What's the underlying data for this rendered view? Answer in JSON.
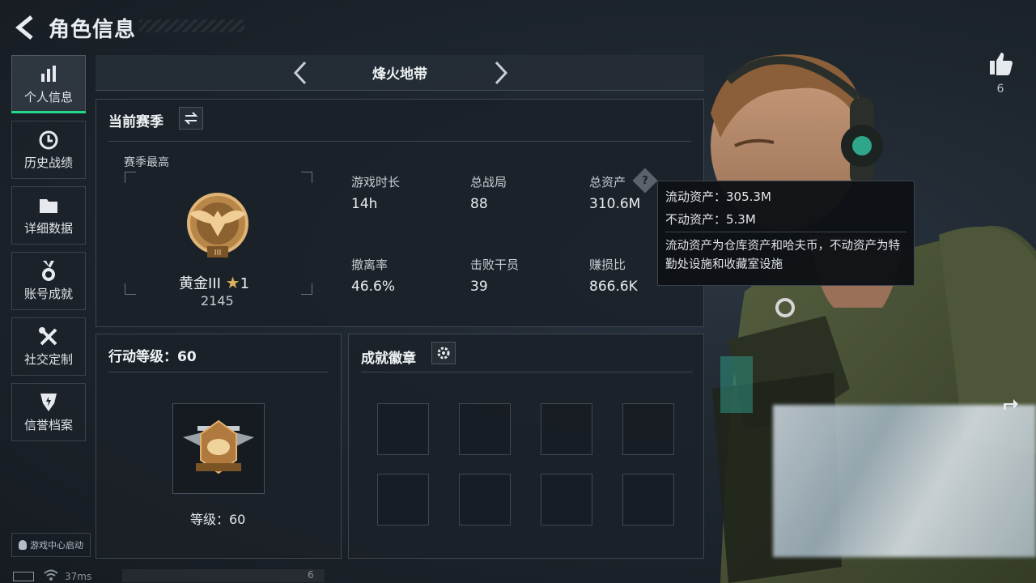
{
  "header": {
    "title": "角色信息"
  },
  "sidebar": {
    "items": [
      {
        "label": "个人信息",
        "icon": "bar-chart-icon",
        "active": true
      },
      {
        "label": "历史战绩",
        "icon": "clock-icon",
        "active": false
      },
      {
        "label": "详细数据",
        "icon": "folder-icon",
        "active": false
      },
      {
        "label": "账号成就",
        "icon": "medal-icon",
        "active": false
      },
      {
        "label": "社交定制",
        "icon": "tools-icon",
        "active": false
      },
      {
        "label": "信誉档案",
        "icon": "shield-icon",
        "active": false
      }
    ],
    "game_center": "游戏中心启动"
  },
  "status": {
    "ping": "37ms",
    "count": "6"
  },
  "mode": {
    "title": "烽火地带"
  },
  "season": {
    "title": "当前赛季",
    "best_label": "赛季最高",
    "rank_name": "黄金III",
    "rank_star": "1",
    "rank_points": "2145",
    "stats": [
      {
        "label": "游戏时长",
        "value": "14h"
      },
      {
        "label": "总战局",
        "value": "88"
      },
      {
        "label": "总资产",
        "value": "310.6M"
      },
      {
        "label": "撤离率",
        "value": "46.6%"
      },
      {
        "label": "击败干员",
        "value": "39"
      },
      {
        "label": "赚损比",
        "value": "866.6K"
      }
    ]
  },
  "tooltip": {
    "liquid": "流动资产：305.3M",
    "fixed": "不动资产：5.3M",
    "description": "流动资产为仓库资产和哈夫币，不动资产为特勤处设施和收藏室设施"
  },
  "action_level": {
    "title": "行动等级：60",
    "level_label": "等级：60"
  },
  "achievements": {
    "title": "成就徽章"
  },
  "likes": {
    "count": "6"
  },
  "colors": {
    "accent": "#1fdc8b",
    "background": "#1b2128",
    "gold": "#c8954a"
  }
}
